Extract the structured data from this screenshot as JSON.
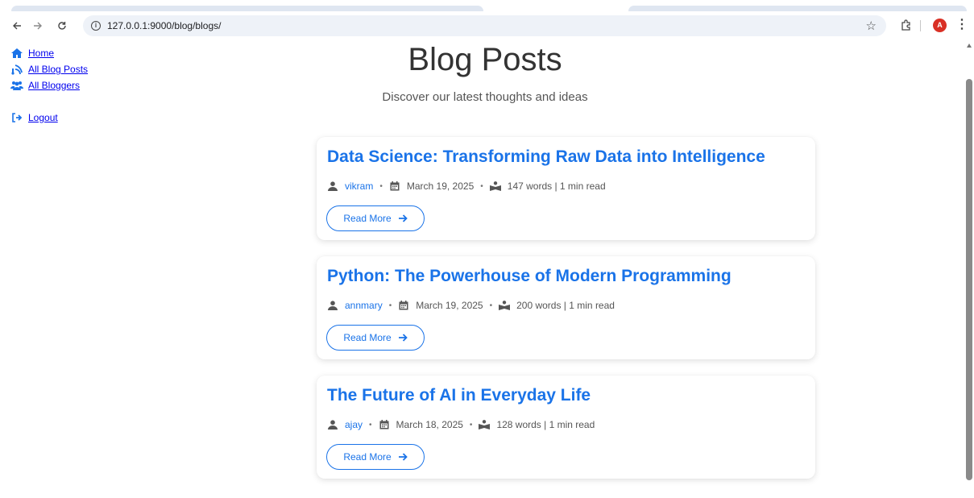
{
  "browser": {
    "url": "127.0.0.1:9000/blog/blogs/",
    "avatar_letter": "A",
    "accent_color": "#1a73e8"
  },
  "sidebar": {
    "items": [
      {
        "label": "Home",
        "icon": "home-icon"
      },
      {
        "label": "All Blog Posts",
        "icon": "blog-posts-icon"
      },
      {
        "label": "All Bloggers",
        "icon": "users-icon"
      },
      {
        "label": "Logout",
        "icon": "logout-icon"
      }
    ]
  },
  "header": {
    "title": "Blog Posts",
    "subtitle": "Discover our latest thoughts and ideas"
  },
  "posts": [
    {
      "title": "Data Science: Transforming Raw Data into Intelligence",
      "author": "vikram",
      "date": "March 19, 2025",
      "stats": "147 words | 1 min read",
      "read_more": "Read More"
    },
    {
      "title": "Python: The Powerhouse of Modern Programming",
      "author": "annmary",
      "date": "March 19, 2025",
      "stats": "200 words | 1 min read",
      "read_more": "Read More"
    },
    {
      "title": "The Future of AI in Everyday Life",
      "author": "ajay",
      "date": "March 18, 2025",
      "stats": "128 words | 1 min read",
      "read_more": "Read More"
    }
  ]
}
